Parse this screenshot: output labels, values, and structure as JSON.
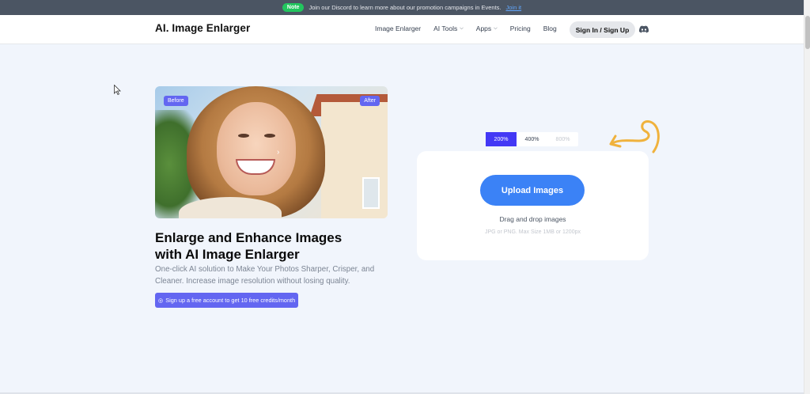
{
  "notice": {
    "badge": "Note",
    "text": "Join our Discord to learn more about our promotion campaigns in Events.",
    "link": "Join it"
  },
  "header": {
    "logo": "AI. Image Enlarger",
    "nav": [
      {
        "label": "Image Enlarger",
        "dropdown": false
      },
      {
        "label": "AI Tools",
        "dropdown": true
      },
      {
        "label": "Apps",
        "dropdown": true
      },
      {
        "label": "Pricing",
        "dropdown": false
      },
      {
        "label": "Blog",
        "dropdown": false
      }
    ],
    "signin_label": "Sign In / Sign Up",
    "discord_icon": "discord-icon"
  },
  "hero": {
    "before_label": "Before",
    "after_label": "After",
    "headline_line1": "Enlarge and Enhance Images",
    "headline_line2": "with AI Image Enlarger",
    "subtext": "One-click AI solution to Make Your Photos Sharper, Crisper, and Cleaner. Increase image resolution without losing quality.",
    "cta_label": "Sign up a free account to get 10 free credits/month"
  },
  "upload": {
    "scales": [
      {
        "label": "200%",
        "state": "active"
      },
      {
        "label": "400%",
        "state": "normal"
      },
      {
        "label": "800%",
        "state": "disabled"
      }
    ],
    "button_label": "Upload Images",
    "drag_text": "Drag and drop images",
    "hint_text": "JPG or PNG. Max Size 1MB or 1200px"
  },
  "colors": {
    "accent": "#6366f1",
    "upload_button": "#3b82f6",
    "scale_active": "#4338f5",
    "notice_badge": "#22c55e",
    "doodle": "#f0b23d"
  }
}
